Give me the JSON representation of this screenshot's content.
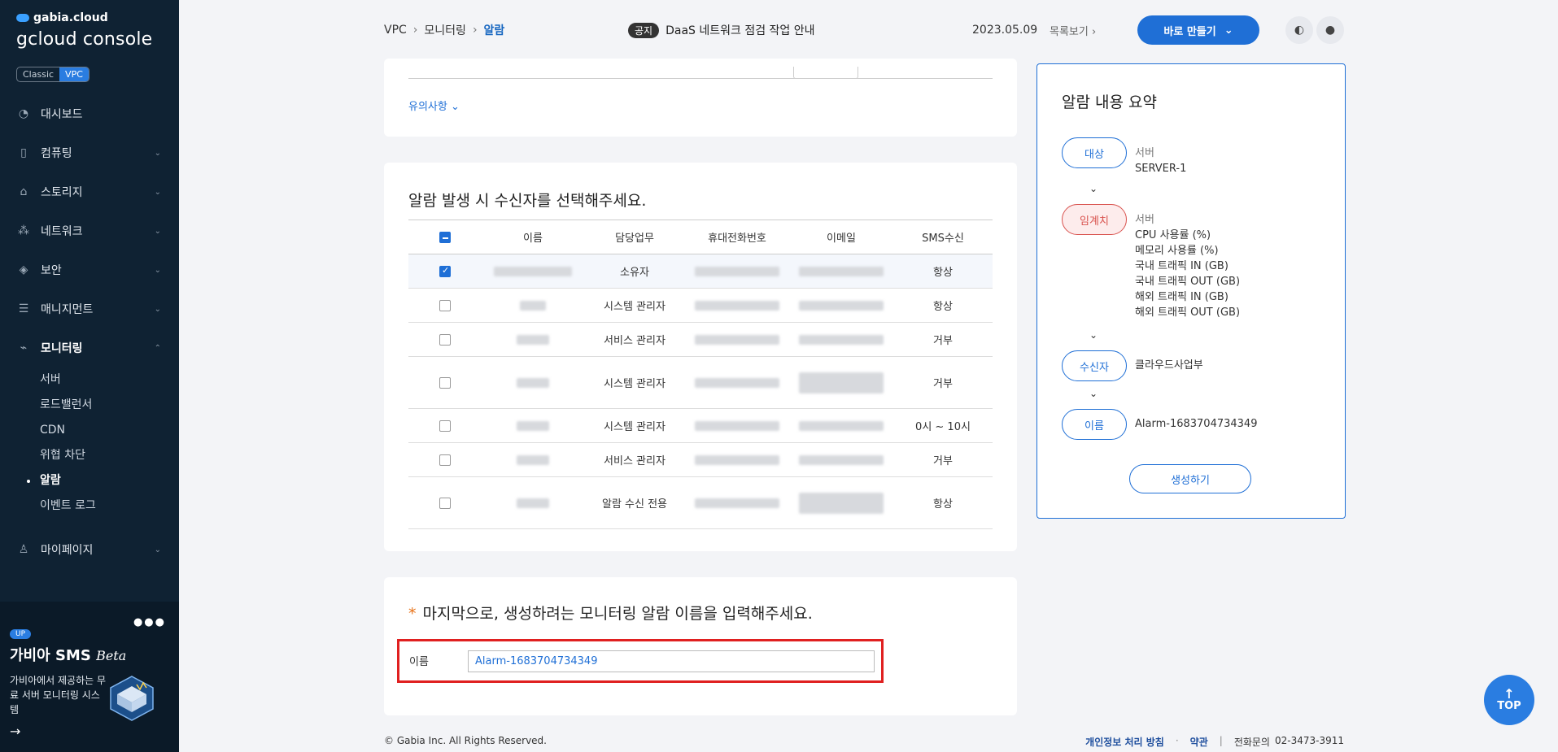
{
  "sidebar": {
    "brand_top": "gabia.cloud",
    "brand_main": "gcloud console",
    "mode_options": [
      "Classic",
      "VPC"
    ],
    "mode_active": "VPC",
    "nav": [
      {
        "label": "대시보드",
        "icon": "dashboard-icon"
      },
      {
        "label": "컴퓨팅",
        "icon": "chip-icon"
      },
      {
        "label": "스토리지",
        "icon": "storage-icon"
      },
      {
        "label": "네트워크",
        "icon": "network-icon"
      },
      {
        "label": "보안",
        "icon": "shield-icon"
      },
      {
        "label": "매니지먼트",
        "icon": "management-icon"
      },
      {
        "label": "모니터링",
        "icon": "monitoring-icon"
      }
    ],
    "monitoring_sub": [
      "서버",
      "로드밸런서",
      "CDN",
      "위협 차단",
      "알람",
      "이벤트 로그"
    ],
    "monitoring_sub_active": "알람",
    "mypage": "마이페이지",
    "promo": {
      "badge": "UP",
      "title": "가비아 SMS",
      "beta": "Beta",
      "desc": "가비아에서 제공하는 무료 서버 모니터링 시스템"
    }
  },
  "header": {
    "breadcrumb": [
      "VPC",
      "모니터링",
      "알람"
    ],
    "notice_tag": "공지",
    "notice_text": "DaaS 네트워크 점검 작업 안내",
    "date": "2023.05.09",
    "more": "목록보기",
    "make_button": "바로 만들기"
  },
  "notes_link": "유의사항",
  "recipients": {
    "title": "알람 발생 시 수신자를 선택해주세요.",
    "columns": [
      "이름",
      "담당업무",
      "휴대전화번호",
      "이메일",
      "SMS수신"
    ],
    "rows": [
      {
        "role": "소유자",
        "sms": "항상",
        "checked": true
      },
      {
        "role": "시스템 관리자",
        "sms": "항상",
        "checked": false
      },
      {
        "role": "서비스 관리자",
        "sms": "거부",
        "checked": false
      },
      {
        "role": "시스템 관리자",
        "sms": "거부",
        "checked": false
      },
      {
        "role": "시스템 관리자",
        "sms": "0시 ~ 10시",
        "checked": false
      },
      {
        "role": "서비스 관리자",
        "sms": "거부",
        "checked": false
      },
      {
        "role": "알람 수신 전용",
        "sms": "항상",
        "checked": false
      }
    ]
  },
  "alarm_name": {
    "title": "마지막으로, 생성하려는 모니터링 알람 이름을 입력해주세요.",
    "required_mark": "*",
    "label": "이름",
    "value": "Alarm-1683704734349"
  },
  "footer": {
    "copyright": "© Gabia Inc. All Rights Reserved.",
    "privacy": "개인정보 처리 방침",
    "dot": "·",
    "terms": "약관",
    "divider": "|",
    "contact_label": "전화문의",
    "contact_number": "02-3473-3911"
  },
  "summary": {
    "title": "알람 내용 요약",
    "target_pill": "대상",
    "target_type": "서버",
    "target_value": "SERVER-1",
    "threshold_pill": "임계치",
    "threshold_type": "서버",
    "threshold_items": [
      "CPU 사용률 (%)",
      "메모리 사용률 (%)",
      "국내 트래픽 IN (GB)",
      "국내 트래픽 OUT (GB)",
      "해외 트래픽 IN (GB)",
      "해외 트래픽 OUT (GB)"
    ],
    "recipient_pill": "수신자",
    "recipient_value": "클라우드사업부",
    "name_pill": "이름",
    "name_value": "Alarm-1683704734349",
    "create_button": "생성하기"
  },
  "top_button": "TOP"
}
